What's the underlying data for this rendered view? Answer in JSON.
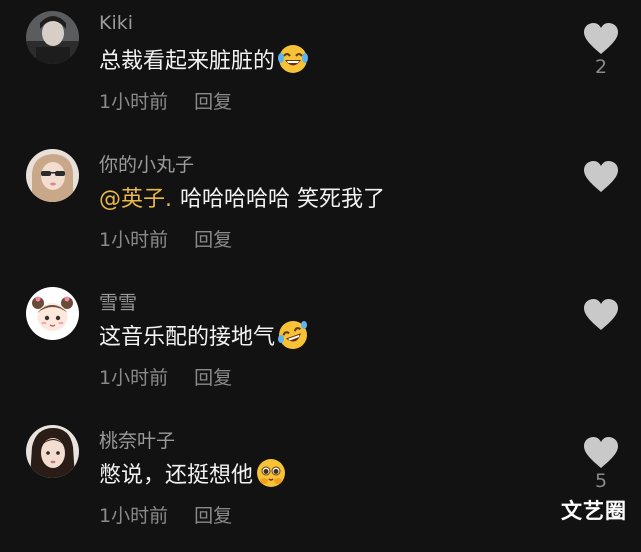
{
  "colors": {
    "background": "#121212",
    "username": "#9a9a9a",
    "text": "#f2f2f2",
    "meta": "#8a8a8a",
    "mention": "#e9b949",
    "heart": "#c9c9c9"
  },
  "comments": [
    {
      "username": "Kiki",
      "mention": "",
      "text": "总裁看起来脏脏的",
      "emoji": "laughing-tears-emoji",
      "time": "1小时前",
      "reply_label": "回复",
      "like_count": "2"
    },
    {
      "username": "你的小丸子",
      "mention": "@英子.",
      "text": "哈哈哈哈哈 笑死我了",
      "emoji": "",
      "time": "1小时前",
      "reply_label": "回复",
      "like_count": ""
    },
    {
      "username": "雪雪",
      "mention": "",
      "text": "这音乐配的接地气",
      "emoji": "rofl-emoji",
      "time": "1小时前",
      "reply_label": "回复",
      "like_count": ""
    },
    {
      "username": "桃奈叶子",
      "mention": "",
      "text": "憋说，还挺想他",
      "emoji": "pleading-emoji",
      "time": "1小时前",
      "reply_label": "回复",
      "like_count": "5"
    }
  ],
  "watermark": "文艺圈"
}
